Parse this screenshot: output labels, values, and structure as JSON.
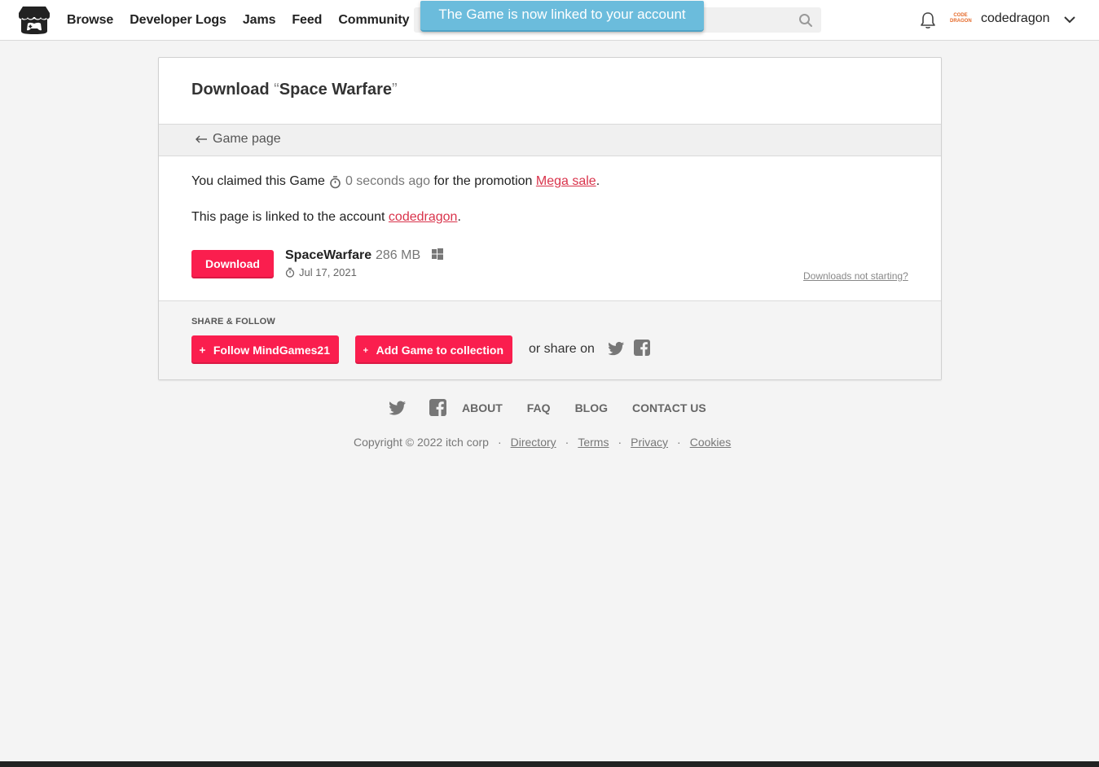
{
  "header": {
    "nav": [
      "Browse",
      "Developer Logs",
      "Jams",
      "Feed",
      "Community"
    ],
    "toast": "The Game is now linked to your account",
    "avatar_text": "CODE DRAGON",
    "username": "codedragon"
  },
  "card": {
    "title_prefix": "Download ",
    "title_open_quote": "“",
    "title_game": "Space Warfare",
    "title_close_quote": "”",
    "back_link": "Game page",
    "claim": {
      "prefix": "You claimed this Game",
      "time": "0 seconds ago",
      "middle": "for the promotion",
      "promotion": "Mega sale",
      "suffix": "."
    },
    "linked": {
      "prefix": "This page is linked to the account ",
      "account": "codedragon",
      "suffix": "."
    },
    "download": {
      "button": "Download",
      "file_name": "SpaceWarfare",
      "file_size": "286 MB",
      "platform_icon": "windows-icon",
      "date": "Jul 17, 2021",
      "help_link": "Downloads not starting?"
    },
    "share": {
      "heading": "SHARE & FOLLOW",
      "follow_button": "Follow MindGames21",
      "collection_button": "Add Game to collection",
      "or_share": "or share on"
    }
  },
  "footer": {
    "links": [
      "ABOUT",
      "FAQ",
      "BLOG",
      "CONTACT US"
    ],
    "copyright": "Copyright © 2022 itch corp",
    "legal": [
      "Directory",
      "Terms",
      "Privacy",
      "Cookies"
    ]
  },
  "colors": {
    "brand_red": "#fa1e4e",
    "link_red": "#d9334b",
    "toast_blue": "#6bbcdc"
  }
}
